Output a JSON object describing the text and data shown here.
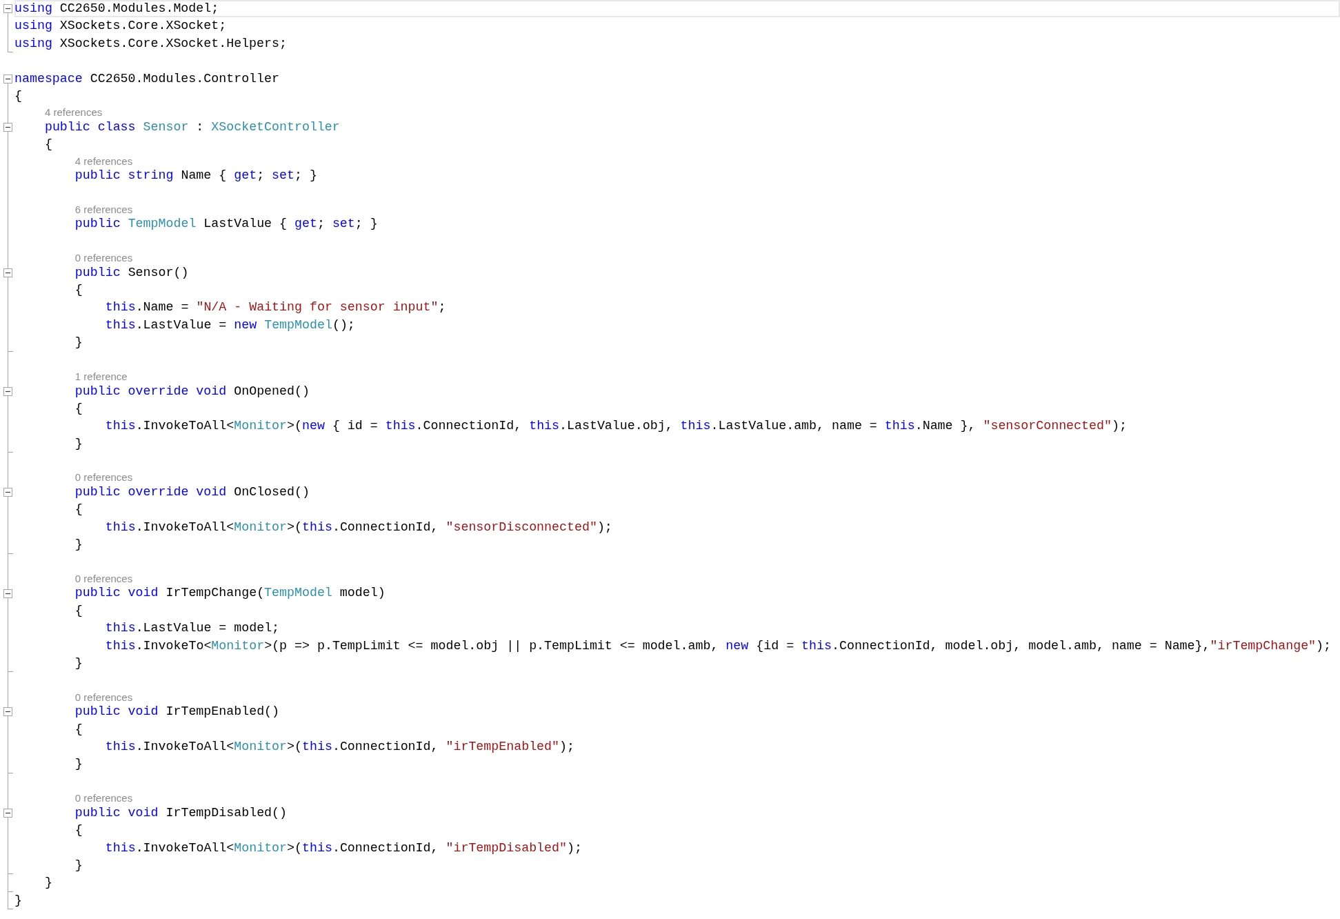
{
  "editor": {
    "items": [
      {
        "kind": "region",
        "expanded": true,
        "children": [
          {
            "kind": "code",
            "current": true,
            "tokens": [
              {
                "kind": "keyword",
                "text": "using"
              },
              {
                "kind": "plain",
                "text": " CC2650.Modules.Model;"
              }
            ]
          },
          {
            "kind": "code",
            "current": false,
            "tokens": [
              {
                "kind": "keyword",
                "text": "using"
              },
              {
                "kind": "plain",
                "text": " XSockets.Core.XSocket;"
              }
            ]
          },
          {
            "kind": "code",
            "current": false,
            "tokens": [
              {
                "kind": "keyword",
                "text": "using"
              },
              {
                "kind": "plain",
                "text": " XSockets.Core.XSocket.Helpers;"
              }
            ]
          }
        ]
      },
      {
        "kind": "blank"
      },
      {
        "kind": "region",
        "expanded": true,
        "children": [
          {
            "kind": "code",
            "current": false,
            "tokens": [
              {
                "kind": "keyword",
                "text": "namespace"
              },
              {
                "kind": "plain",
                "text": " CC2650.Modules.Controller"
              }
            ]
          },
          {
            "kind": "code",
            "current": false,
            "tokens": [
              {
                "kind": "plain",
                "text": "{"
              }
            ]
          },
          {
            "kind": "indent",
            "children": [
              {
                "kind": "lens",
                "text": "4 references"
              },
              {
                "kind": "region",
                "expanded": true,
                "children": [
                  {
                    "kind": "code",
                    "current": false,
                    "tokens": [
                      {
                        "kind": "keyword",
                        "text": "public class"
                      },
                      {
                        "kind": "type",
                        "text": " Sensor"
                      },
                      {
                        "kind": "plain",
                        "text": " : "
                      },
                      {
                        "kind": "type",
                        "text": "XSocketController"
                      }
                    ]
                  },
                  {
                    "kind": "code",
                    "current": false,
                    "tokens": [
                      {
                        "kind": "plain",
                        "text": "{"
                      }
                    ]
                  },
                  {
                    "kind": "indent",
                    "children": [
                      {
                        "kind": "lens",
                        "text": "4 references"
                      },
                      {
                        "kind": "code",
                        "current": false,
                        "tokens": [
                          {
                            "kind": "keyword",
                            "text": "public string"
                          },
                          {
                            "kind": "plain",
                            "text": " Name { "
                          },
                          {
                            "kind": "keyword",
                            "text": "get"
                          },
                          {
                            "kind": "plain",
                            "text": "; "
                          },
                          {
                            "kind": "keyword",
                            "text": "set"
                          },
                          {
                            "kind": "plain",
                            "text": "; }"
                          }
                        ]
                      },
                      {
                        "kind": "blank"
                      },
                      {
                        "kind": "lens",
                        "text": "6 references"
                      },
                      {
                        "kind": "code",
                        "current": false,
                        "tokens": [
                          {
                            "kind": "keyword",
                            "text": "public"
                          },
                          {
                            "kind": "type",
                            "text": " TempModel"
                          },
                          {
                            "kind": "plain",
                            "text": " LastValue { "
                          },
                          {
                            "kind": "keyword",
                            "text": "get"
                          },
                          {
                            "kind": "plain",
                            "text": "; "
                          },
                          {
                            "kind": "keyword",
                            "text": "set"
                          },
                          {
                            "kind": "plain",
                            "text": "; }"
                          }
                        ]
                      },
                      {
                        "kind": "blank"
                      },
                      {
                        "kind": "lens",
                        "text": "0 references"
                      },
                      {
                        "kind": "region",
                        "expanded": true,
                        "children": [
                          {
                            "kind": "code",
                            "current": false,
                            "tokens": [
                              {
                                "kind": "keyword",
                                "text": "public"
                              },
                              {
                                "kind": "plain",
                                "text": " Sensor()"
                              }
                            ]
                          },
                          {
                            "kind": "code",
                            "current": false,
                            "tokens": [
                              {
                                "kind": "plain",
                                "text": "{"
                              }
                            ]
                          },
                          {
                            "kind": "indent",
                            "children": [
                              {
                                "kind": "code",
                                "current": false,
                                "tokens": [
                                  {
                                    "kind": "keyword",
                                    "text": "this"
                                  },
                                  {
                                    "kind": "plain",
                                    "text": ".Name = "
                                  },
                                  {
                                    "kind": "string",
                                    "text": "\"N/A - Waiting for sensor input\""
                                  },
                                  {
                                    "kind": "plain",
                                    "text": ";"
                                  }
                                ]
                              },
                              {
                                "kind": "code",
                                "current": false,
                                "tokens": [
                                  {
                                    "kind": "keyword",
                                    "text": "this"
                                  },
                                  {
                                    "kind": "plain",
                                    "text": ".LastValue = "
                                  },
                                  {
                                    "kind": "keyword",
                                    "text": "new"
                                  },
                                  {
                                    "kind": "type",
                                    "text": " TempModel"
                                  },
                                  {
                                    "kind": "plain",
                                    "text": "();"
                                  }
                                ]
                              }
                            ]
                          },
                          {
                            "kind": "code",
                            "current": false,
                            "tokens": [
                              {
                                "kind": "plain",
                                "text": "}"
                              }
                            ]
                          }
                        ]
                      },
                      {
                        "kind": "blank"
                      },
                      {
                        "kind": "lens",
                        "text": "1 reference"
                      },
                      {
                        "kind": "region",
                        "expanded": true,
                        "children": [
                          {
                            "kind": "code",
                            "current": false,
                            "tokens": [
                              {
                                "kind": "keyword",
                                "text": "public override void"
                              },
                              {
                                "kind": "plain",
                                "text": " OnOpened()"
                              }
                            ]
                          },
                          {
                            "kind": "code",
                            "current": false,
                            "tokens": [
                              {
                                "kind": "plain",
                                "text": "{"
                              }
                            ]
                          },
                          {
                            "kind": "indent",
                            "children": [
                              {
                                "kind": "code",
                                "current": false,
                                "tokens": [
                                  {
                                    "kind": "keyword",
                                    "text": "this"
                                  },
                                  {
                                    "kind": "plain",
                                    "text": ".InvokeToAll<"
                                  },
                                  {
                                    "kind": "type",
                                    "text": "Monitor"
                                  },
                                  {
                                    "kind": "plain",
                                    "text": ">("
                                  },
                                  {
                                    "kind": "keyword",
                                    "text": "new"
                                  },
                                  {
                                    "kind": "plain",
                                    "text": " { id = "
                                  },
                                  {
                                    "kind": "keyword",
                                    "text": "this"
                                  },
                                  {
                                    "kind": "plain",
                                    "text": ".ConnectionId, "
                                  },
                                  {
                                    "kind": "keyword",
                                    "text": "this"
                                  },
                                  {
                                    "kind": "plain",
                                    "text": ".LastValue.obj, "
                                  },
                                  {
                                    "kind": "keyword",
                                    "text": "this"
                                  },
                                  {
                                    "kind": "plain",
                                    "text": ".LastValue.amb, name = "
                                  },
                                  {
                                    "kind": "keyword",
                                    "text": "this"
                                  },
                                  {
                                    "kind": "plain",
                                    "text": ".Name }, "
                                  },
                                  {
                                    "kind": "string",
                                    "text": "\"sensorConnected\""
                                  },
                                  {
                                    "kind": "plain",
                                    "text": ");"
                                  }
                                ]
                              }
                            ]
                          },
                          {
                            "kind": "code",
                            "current": false,
                            "tokens": [
                              {
                                "kind": "plain",
                                "text": "}"
                              }
                            ]
                          }
                        ]
                      },
                      {
                        "kind": "blank"
                      },
                      {
                        "kind": "lens",
                        "text": "0 references"
                      },
                      {
                        "kind": "region",
                        "expanded": true,
                        "children": [
                          {
                            "kind": "code",
                            "current": false,
                            "tokens": [
                              {
                                "kind": "keyword",
                                "text": "public override void"
                              },
                              {
                                "kind": "plain",
                                "text": " OnClosed()"
                              }
                            ]
                          },
                          {
                            "kind": "code",
                            "current": false,
                            "tokens": [
                              {
                                "kind": "plain",
                                "text": "{"
                              }
                            ]
                          },
                          {
                            "kind": "indent",
                            "children": [
                              {
                                "kind": "code",
                                "current": false,
                                "tokens": [
                                  {
                                    "kind": "keyword",
                                    "text": "this"
                                  },
                                  {
                                    "kind": "plain",
                                    "text": ".InvokeToAll<"
                                  },
                                  {
                                    "kind": "type",
                                    "text": "Monitor"
                                  },
                                  {
                                    "kind": "plain",
                                    "text": ">("
                                  },
                                  {
                                    "kind": "keyword",
                                    "text": "this"
                                  },
                                  {
                                    "kind": "plain",
                                    "text": ".ConnectionId, "
                                  },
                                  {
                                    "kind": "string",
                                    "text": "\"sensorDisconnected\""
                                  },
                                  {
                                    "kind": "plain",
                                    "text": ");"
                                  }
                                ]
                              }
                            ]
                          },
                          {
                            "kind": "code",
                            "current": false,
                            "tokens": [
                              {
                                "kind": "plain",
                                "text": "}"
                              }
                            ]
                          }
                        ]
                      },
                      {
                        "kind": "blank"
                      },
                      {
                        "kind": "lens",
                        "text": "0 references"
                      },
                      {
                        "kind": "region",
                        "expanded": true,
                        "children": [
                          {
                            "kind": "code",
                            "current": false,
                            "tokens": [
                              {
                                "kind": "keyword",
                                "text": "public void"
                              },
                              {
                                "kind": "plain",
                                "text": " IrTempChange("
                              },
                              {
                                "kind": "type",
                                "text": "TempModel"
                              },
                              {
                                "kind": "plain",
                                "text": " model)"
                              }
                            ]
                          },
                          {
                            "kind": "code",
                            "current": false,
                            "tokens": [
                              {
                                "kind": "plain",
                                "text": "{"
                              }
                            ]
                          },
                          {
                            "kind": "indent",
                            "children": [
                              {
                                "kind": "code",
                                "current": false,
                                "tokens": [
                                  {
                                    "kind": "keyword",
                                    "text": "this"
                                  },
                                  {
                                    "kind": "plain",
                                    "text": ".LastValue = model;"
                                  }
                                ]
                              },
                              {
                                "kind": "code",
                                "current": false,
                                "tokens": [
                                  {
                                    "kind": "keyword",
                                    "text": "this"
                                  },
                                  {
                                    "kind": "plain",
                                    "text": ".InvokeTo<"
                                  },
                                  {
                                    "kind": "type",
                                    "text": "Monitor"
                                  },
                                  {
                                    "kind": "plain",
                                    "text": ">(p => p.TempLimit <= model.obj || p.TempLimit <= model.amb, "
                                  },
                                  {
                                    "kind": "keyword",
                                    "text": "new"
                                  },
                                  {
                                    "kind": "plain",
                                    "text": " {id = "
                                  },
                                  {
                                    "kind": "keyword",
                                    "text": "this"
                                  },
                                  {
                                    "kind": "plain",
                                    "text": ".ConnectionId, model.obj, model.amb, name = Name},"
                                  },
                                  {
                                    "kind": "string",
                                    "text": "\"irTempChange\""
                                  },
                                  {
                                    "kind": "plain",
                                    "text": ");"
                                  }
                                ]
                              }
                            ]
                          },
                          {
                            "kind": "code",
                            "current": false,
                            "tokens": [
                              {
                                "kind": "plain",
                                "text": "}"
                              }
                            ]
                          }
                        ]
                      },
                      {
                        "kind": "blank"
                      },
                      {
                        "kind": "lens",
                        "text": "0 references"
                      },
                      {
                        "kind": "region",
                        "expanded": true,
                        "children": [
                          {
                            "kind": "code",
                            "current": false,
                            "tokens": [
                              {
                                "kind": "keyword",
                                "text": "public void"
                              },
                              {
                                "kind": "plain",
                                "text": " IrTempEnabled()"
                              }
                            ]
                          },
                          {
                            "kind": "code",
                            "current": false,
                            "tokens": [
                              {
                                "kind": "plain",
                                "text": "{"
                              }
                            ]
                          },
                          {
                            "kind": "indent",
                            "children": [
                              {
                                "kind": "code",
                                "current": false,
                                "tokens": [
                                  {
                                    "kind": "keyword",
                                    "text": "this"
                                  },
                                  {
                                    "kind": "plain",
                                    "text": ".InvokeToAll<"
                                  },
                                  {
                                    "kind": "type",
                                    "text": "Monitor"
                                  },
                                  {
                                    "kind": "plain",
                                    "text": ">("
                                  },
                                  {
                                    "kind": "keyword",
                                    "text": "this"
                                  },
                                  {
                                    "kind": "plain",
                                    "text": ".ConnectionId, "
                                  },
                                  {
                                    "kind": "string",
                                    "text": "\"irTempEnabled\""
                                  },
                                  {
                                    "kind": "plain",
                                    "text": ");"
                                  }
                                ]
                              }
                            ]
                          },
                          {
                            "kind": "code",
                            "current": false,
                            "tokens": [
                              {
                                "kind": "plain",
                                "text": "}"
                              }
                            ]
                          }
                        ]
                      },
                      {
                        "kind": "blank"
                      },
                      {
                        "kind": "lens",
                        "text": "0 references"
                      },
                      {
                        "kind": "region",
                        "expanded": true,
                        "children": [
                          {
                            "kind": "code",
                            "current": false,
                            "tokens": [
                              {
                                "kind": "keyword",
                                "text": "public void"
                              },
                              {
                                "kind": "plain",
                                "text": " IrTempDisabled()"
                              }
                            ]
                          },
                          {
                            "kind": "code",
                            "current": false,
                            "tokens": [
                              {
                                "kind": "plain",
                                "text": "{"
                              }
                            ]
                          },
                          {
                            "kind": "indent",
                            "children": [
                              {
                                "kind": "code",
                                "current": false,
                                "tokens": [
                                  {
                                    "kind": "keyword",
                                    "text": "this"
                                  },
                                  {
                                    "kind": "plain",
                                    "text": ".InvokeToAll<"
                                  },
                                  {
                                    "kind": "type",
                                    "text": "Monitor"
                                  },
                                  {
                                    "kind": "plain",
                                    "text": ">("
                                  },
                                  {
                                    "kind": "keyword",
                                    "text": "this"
                                  },
                                  {
                                    "kind": "plain",
                                    "text": ".ConnectionId, "
                                  },
                                  {
                                    "kind": "string",
                                    "text": "\"irTempDisabled\""
                                  },
                                  {
                                    "kind": "plain",
                                    "text": ");"
                                  }
                                ]
                              }
                            ]
                          },
                          {
                            "kind": "code",
                            "current": false,
                            "tokens": [
                              {
                                "kind": "plain",
                                "text": "}"
                              }
                            ]
                          }
                        ]
                      }
                    ]
                  },
                  {
                    "kind": "code",
                    "current": false,
                    "tokens": [
                      {
                        "kind": "plain",
                        "text": "}"
                      }
                    ]
                  }
                ]
              }
            ]
          },
          {
            "kind": "code",
            "current": false,
            "tokens": [
              {
                "kind": "plain",
                "text": "}"
              }
            ]
          }
        ]
      }
    ]
  }
}
